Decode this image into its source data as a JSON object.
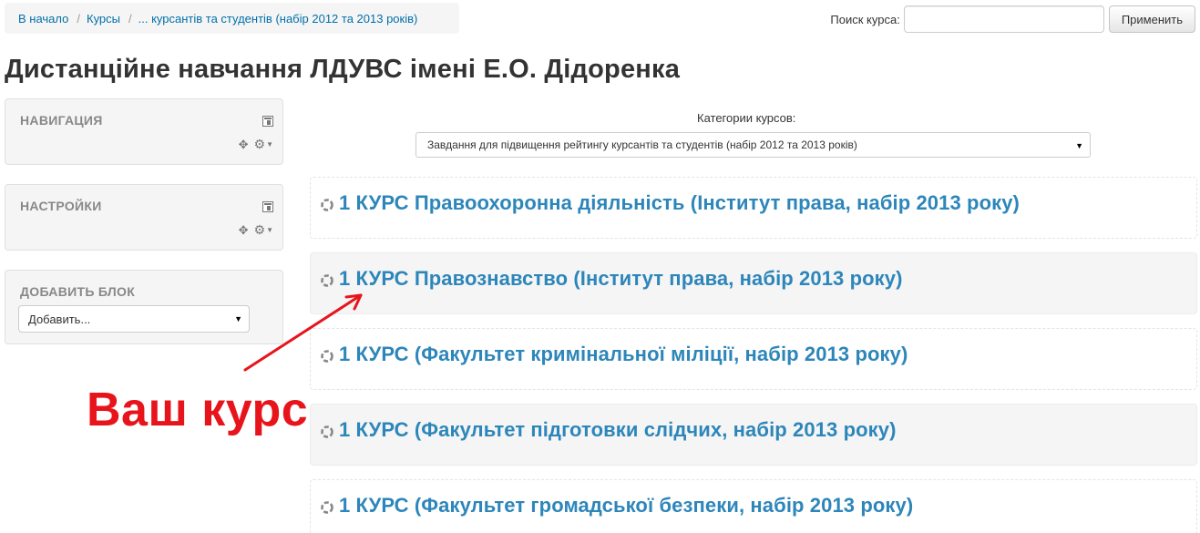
{
  "breadcrumb": [
    {
      "label": "В начало"
    },
    {
      "label": "Курсы"
    },
    {
      "label": "... курсантів та студентів (набір 2012 та 2013 років)"
    }
  ],
  "search": {
    "label": "Поиск курса:",
    "value": "",
    "button_label": "Применить"
  },
  "page_title": "Дистанційне навчання ЛДУВС імені Е.О. Дідоренка",
  "blocks": {
    "navigation": {
      "title": "НАВИГАЦИЯ"
    },
    "settings": {
      "title": "НАСТРОЙКИ"
    },
    "add_block": {
      "title": "ДОБАВИТЬ БЛОК",
      "select_value": "Добавить..."
    }
  },
  "categories": {
    "label": "Категории курсов:",
    "selected": "Завдання для підвищення рейтингу курсантів та студентів (набір 2012 та 2013 років)"
  },
  "courses": [
    {
      "name": "1 КУРС Правоохоронна діяльність (Інститут права, набір 2013 року)"
    },
    {
      "name": "1 КУРС Правознавство (Інститут права, набір 2013 року)"
    },
    {
      "name": "1 КУРС (Факультет кримінальної міліції, набір 2013 року)"
    },
    {
      "name": "1 КУРС (Факультет підготовки слідчих, набір 2013 року)"
    },
    {
      "name": "1 КУРС (Факультет громадської безпеки, набір 2013 року)"
    }
  ],
  "annotation": {
    "text": "Ваш курс",
    "color": "#e8141b"
  },
  "colors": {
    "link": "#2d86ba",
    "breadcrumb_link": "#0070a8",
    "block_bg": "#f5f5f5"
  },
  "icons": {
    "course": "course-icon",
    "move": "move-icon",
    "gear": "gear-icon",
    "dock": "dock-icon"
  }
}
